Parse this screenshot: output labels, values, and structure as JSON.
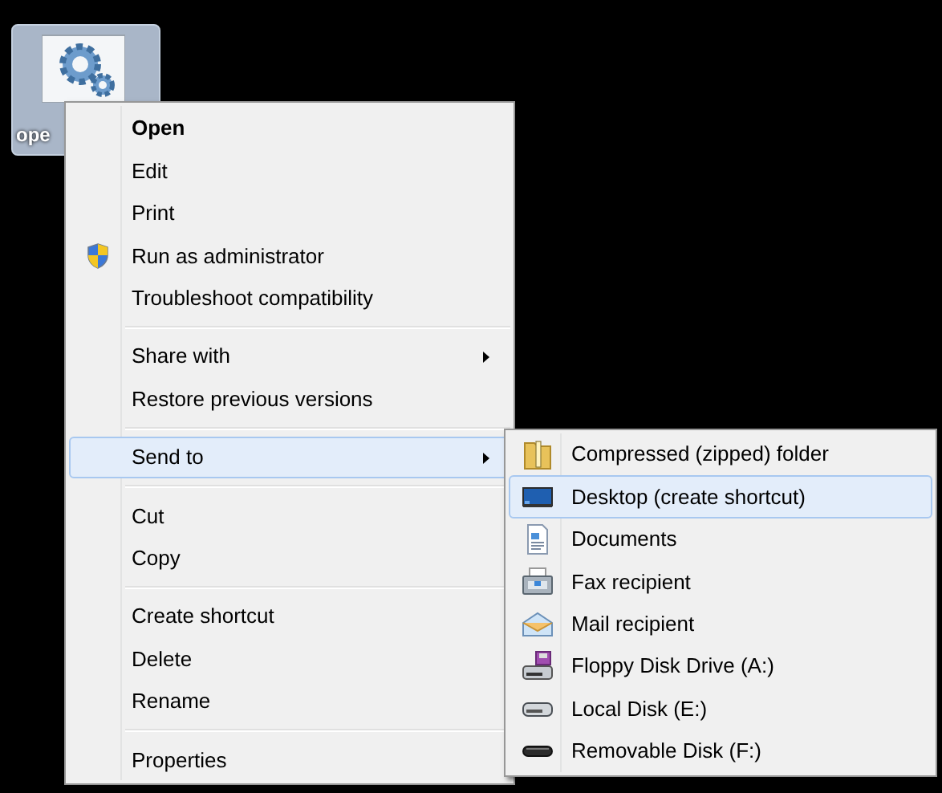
{
  "desktop_icon": {
    "label": "ope",
    "selected": true
  },
  "context_menu": {
    "items": [
      {
        "kind": "item",
        "label": "Open",
        "default": true,
        "selected": false,
        "submenu": false
      },
      {
        "kind": "item",
        "label": "Edit",
        "default": false,
        "selected": false,
        "submenu": false
      },
      {
        "kind": "item",
        "label": "Print",
        "default": false,
        "selected": false,
        "submenu": false
      },
      {
        "kind": "admin_item",
        "label": "Run as administrator",
        "default": false,
        "selected": false,
        "submenu": false
      },
      {
        "kind": "item",
        "label": "Troubleshoot compatibility",
        "default": false,
        "selected": false,
        "submenu": false
      },
      {
        "kind": "separator"
      },
      {
        "kind": "item",
        "label": "Share with",
        "default": false,
        "selected": false,
        "submenu": true
      },
      {
        "kind": "item",
        "label": "Restore previous versions",
        "default": false,
        "selected": false,
        "submenu": false
      },
      {
        "kind": "separator"
      },
      {
        "kind": "item",
        "label": "Send to",
        "default": false,
        "selected": true,
        "submenu": true
      },
      {
        "kind": "separator"
      },
      {
        "kind": "item",
        "label": "Cut",
        "default": false,
        "selected": false,
        "submenu": false
      },
      {
        "kind": "item",
        "label": "Copy",
        "default": false,
        "selected": false,
        "submenu": false
      },
      {
        "kind": "separator"
      },
      {
        "kind": "item",
        "label": "Create shortcut",
        "default": false,
        "selected": false,
        "submenu": false
      },
      {
        "kind": "item",
        "label": "Delete",
        "default": false,
        "selected": false,
        "submenu": false
      },
      {
        "kind": "item",
        "label": "Rename",
        "default": false,
        "selected": false,
        "submenu": false
      },
      {
        "kind": "separator"
      },
      {
        "kind": "item",
        "label": "Properties",
        "default": false,
        "selected": false,
        "submenu": false
      }
    ]
  },
  "send_to_menu": {
    "items": [
      {
        "kind": "zip",
        "label": "Compressed (zipped) folder",
        "selected": false
      },
      {
        "kind": "desktop",
        "label": "Desktop (create shortcut)",
        "selected": true
      },
      {
        "kind": "documents",
        "label": "Documents",
        "selected": false
      },
      {
        "kind": "fax",
        "label": "Fax recipient",
        "selected": false
      },
      {
        "kind": "mail",
        "label": "Mail recipient",
        "selected": false
      },
      {
        "kind": "floppy",
        "label": "Floppy Disk Drive (A:)",
        "selected": false
      },
      {
        "kind": "disk",
        "label": "Local Disk (E:)",
        "selected": false
      },
      {
        "kind": "removable",
        "label": "Removable Disk (F:)",
        "selected": false
      }
    ]
  }
}
